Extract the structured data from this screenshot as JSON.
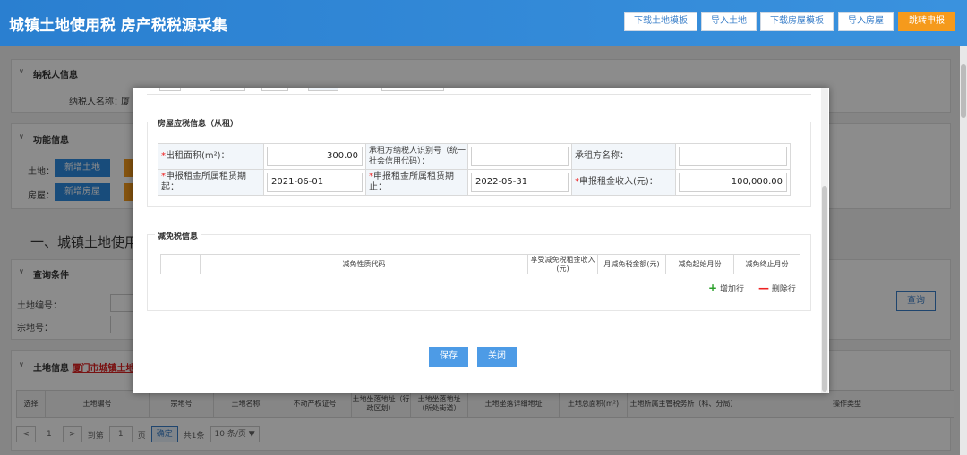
{
  "header": {
    "title": "城镇土地使用税 房产税税源采集",
    "buttons": [
      "下载土地模板",
      "导入土地",
      "下载房屋模板",
      "导入房屋",
      "跳转申报"
    ]
  },
  "background": {
    "taxpayer_section": "纳税人信息",
    "taxpayer_label": "纳税人名称：",
    "taxpayer_value_fragment": "厦",
    "function_section": "功能信息",
    "land_label": "土地：",
    "add_land": "新增土地",
    "house_label": "房屋：",
    "add_house": "新增房屋",
    "big_heading": "一、城镇土地使用税",
    "query_section": "查询条件",
    "land_no_label": "土地编号：",
    "parcel_label": "宗地号：",
    "query_button": "查询",
    "land_info_section": "土地信息",
    "land_info_link": "厦门市城镇土地使",
    "table_headers": [
      "选择",
      "土地编号",
      "宗地号",
      "土地名称",
      "不动产权证号",
      "土地坐落地址（行政区划）",
      "土地坐落地址（所处街道）",
      "土地坐落详细地址",
      "土地总面积(m²)",
      "土地所属主管税务所（科、分局）",
      "操作类型"
    ],
    "pager": {
      "prev": "<",
      "page": "1",
      "next": ">",
      "goto_label": "到第",
      "goto_value": "1",
      "page_unit": "页",
      "confirm": "确定",
      "total": "共1条",
      "page_size": "10 条/页 ▼"
    }
  },
  "modal": {
    "rent_section": "房屋应税信息（从租）",
    "rent_area_label": "出租面积(m²)：",
    "rent_area_value": "300.00",
    "lessee_id_label": "承租方纳税人识别号（统一社会信用代码）：",
    "lessee_id_value": "",
    "lessee_name_label": "承租方名称：",
    "lessee_name_value": "",
    "period_start_label": "申报租金所属租赁期起：",
    "period_start_value": "2021-06-01",
    "period_end_label": "申报租金所属租赁期止：",
    "period_end_value": "2022-05-31",
    "rent_income_label": "申报租金收入(元)：",
    "rent_income_value": "100,000.00",
    "required_mark": "*",
    "relief_section": "减免税信息",
    "relief_headers": [
      "",
      "减免性质代码",
      "享受减免税租金收入(元)",
      "月减免税金额(元)",
      "减免起始月份",
      "减免终止月份"
    ],
    "add_row": "增加行",
    "del_row": "删除行",
    "add_icon": "+",
    "del_icon": "—",
    "save": "保存",
    "close": "关闭"
  }
}
